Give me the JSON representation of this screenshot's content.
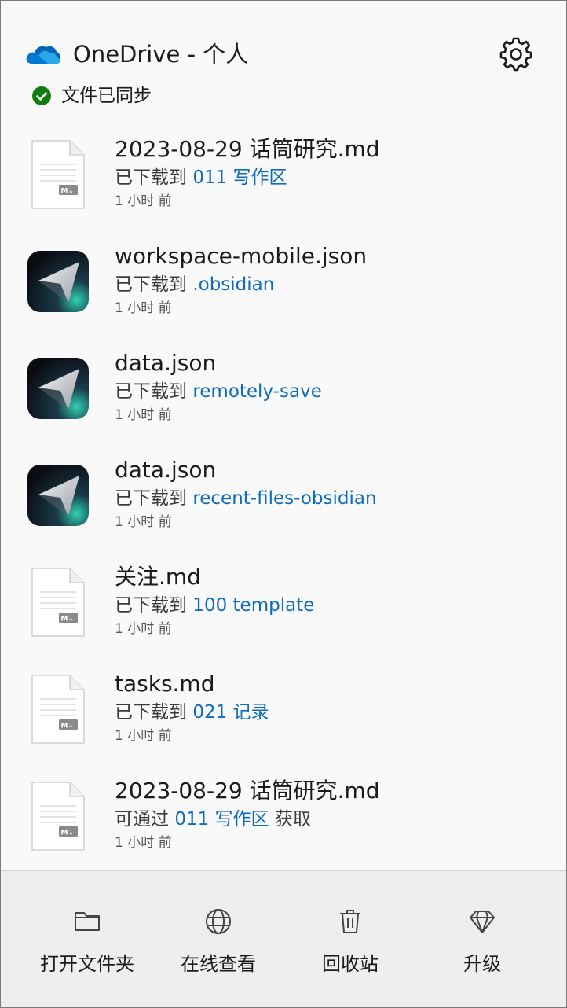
{
  "header": {
    "title": "OneDrive - 个人",
    "sync_status": "文件已同步",
    "cloud_icon": "onedrive-cloud-icon",
    "settings_icon": "gear-icon"
  },
  "colors": {
    "link": "#0f6cbd",
    "sync_ok": "#107c10",
    "background": "#f9f9f9",
    "toolbar_bg": "#eeeeee"
  },
  "files": [
    {
      "name": "2023-08-29 话筒研究.md",
      "status_prefix": "已下载到 ",
      "folder": "011 写作区",
      "status_suffix": "",
      "time": "1 小时 前",
      "icon": "markdown-file-icon"
    },
    {
      "name": "workspace-mobile.json",
      "status_prefix": "已下载到 ",
      "folder": ".obsidian",
      "status_suffix": "",
      "time": "1 小时 前",
      "icon": "obsidian-app-icon"
    },
    {
      "name": "data.json",
      "status_prefix": "已下载到 ",
      "folder": "remotely-save",
      "status_suffix": "",
      "time": "1 小时 前",
      "icon": "obsidian-app-icon"
    },
    {
      "name": "data.json",
      "status_prefix": "已下载到 ",
      "folder": "recent-files-obsidian",
      "status_suffix": "",
      "time": "1 小时 前",
      "icon": "obsidian-app-icon"
    },
    {
      "name": "关注.md",
      "status_prefix": "已下载到 ",
      "folder": "100 template",
      "status_suffix": "",
      "time": "1 小时 前",
      "icon": "markdown-file-icon"
    },
    {
      "name": "tasks.md",
      "status_prefix": "已下载到 ",
      "folder": "021 记录",
      "status_suffix": "",
      "time": "1 小时 前",
      "icon": "markdown-file-icon"
    },
    {
      "name": "2023-08-29 话筒研究.md",
      "status_prefix": "可通过 ",
      "folder": "011 写作区",
      "status_suffix": " 获取",
      "time": "1 小时 前",
      "icon": "markdown-file-icon"
    }
  ],
  "toolbar": {
    "open_folder": {
      "label": "打开文件夹",
      "icon": "folder-icon"
    },
    "view_online": {
      "label": "在线查看",
      "icon": "globe-icon"
    },
    "recycle_bin": {
      "label": "回收站",
      "icon": "trash-icon"
    },
    "upgrade": {
      "label": "升级",
      "icon": "diamond-icon"
    }
  }
}
